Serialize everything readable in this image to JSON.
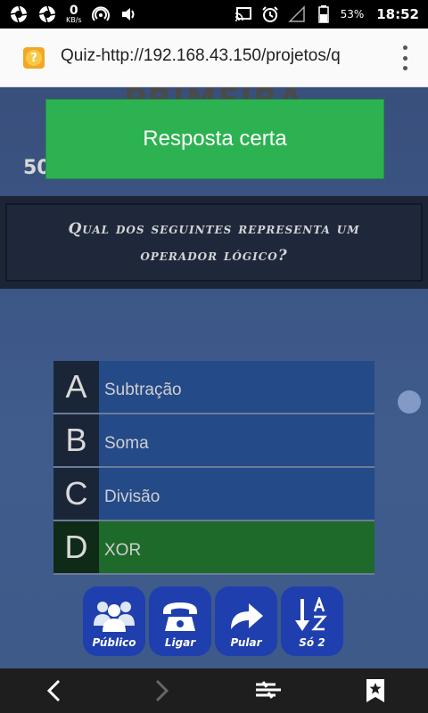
{
  "status_bar": {
    "speed_value": "0",
    "speed_unit": "KB/s",
    "battery_percent": "53%",
    "time": "18:52",
    "icons": [
      "aperture-icon",
      "aperture-icon",
      "hotspot-icon",
      "volume-icon",
      "cast-icon",
      "alarm-icon",
      "signal-icon",
      "battery-icon"
    ]
  },
  "browser": {
    "url_text": "Quiz-http://192.168.43.150/projetos/q",
    "favicon_glyph": "?"
  },
  "game": {
    "round_title": "PRIMEIRA RONDA",
    "score": "50",
    "toast": "Resposta certa",
    "question": "Qual dos seguintes representa um operador lógico?",
    "answers": [
      {
        "letter": "A",
        "text": "Subtração",
        "correct": false
      },
      {
        "letter": "B",
        "text": "Soma",
        "correct": false
      },
      {
        "letter": "C",
        "text": "Divisão",
        "correct": false
      },
      {
        "letter": "D",
        "text": "XOR",
        "correct": true
      }
    ],
    "lifelines": [
      {
        "label": "Público",
        "icon": "audience-icon"
      },
      {
        "label": "Ligar",
        "icon": "phone-icon"
      },
      {
        "label": "Pular",
        "icon": "skip-arrow-icon"
      },
      {
        "label": "Só 2",
        "icon": "sort-az-icon"
      }
    ]
  },
  "colors": {
    "toast_green": "#2db251",
    "answer_blue": "#244a88",
    "answer_correct": "#1d6a2a",
    "lifeline_blue": "#1f3fae"
  }
}
